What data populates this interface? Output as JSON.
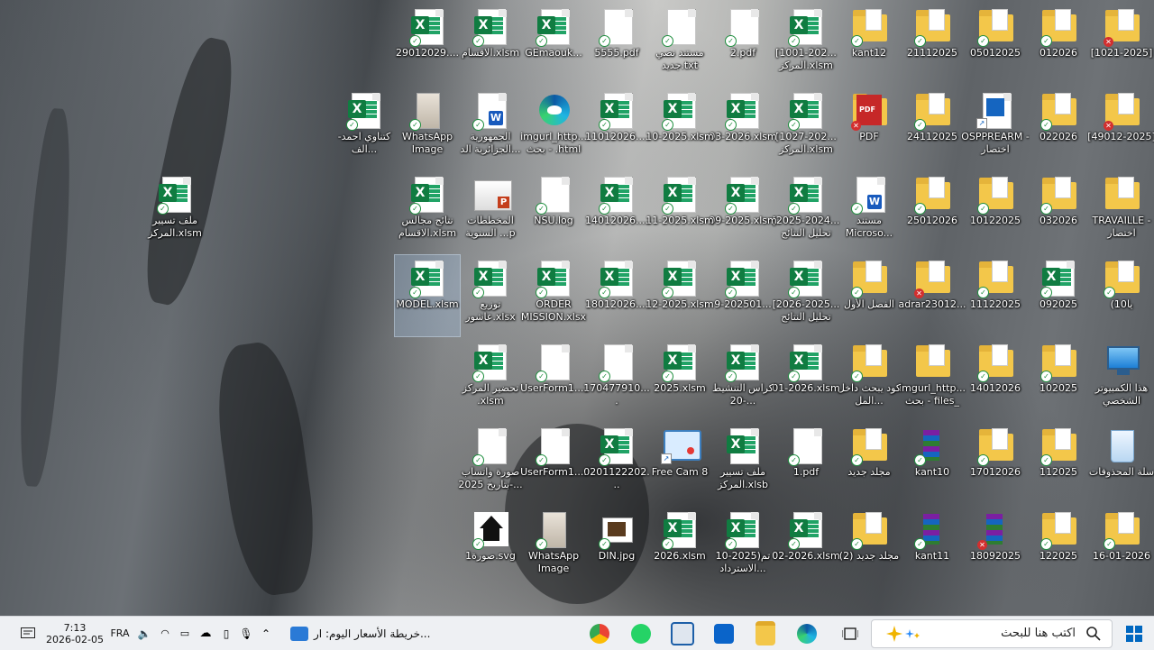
{
  "desktop": {
    "icons": [
      {
        "label": "[1021-2025]",
        "type": "folder",
        "badge": "err"
      },
      {
        "label": "012026",
        "type": "folder",
        "badge": "ok"
      },
      {
        "label": "05012025",
        "type": "folder",
        "badge": "ok"
      },
      {
        "label": "21112025",
        "type": "folder",
        "badge": "ok"
      },
      {
        "label": "kant12",
        "type": "folder",
        "badge": "ok"
      },
      {
        "label": "[1001-202... المركز.xlsm",
        "type": "excel",
        "badge": "ok"
      },
      {
        "label": "2.pdf",
        "type": "doc",
        "badge": "ok"
      },
      {
        "label": "مستند نصي جديد.txt",
        "type": "doc",
        "badge": "ok"
      },
      {
        "label": "5555.pdf",
        "type": "doc",
        "badge": "ok"
      },
      {
        "label": "GEmaouk...",
        "type": "excel",
        "badge": "ok"
      },
      {
        "label": "الاقسام.xlsm",
        "type": "excel",
        "badge": "ok"
      },
      {
        "label": "29012029....",
        "type": "excel",
        "badge": "ok"
      },
      {
        "label": "[49012-2025]",
        "type": "folder",
        "badge": "err"
      },
      {
        "label": "022026",
        "type": "folder",
        "badge": "ok"
      },
      {
        "label": "OSPPREARM - اختصار",
        "type": "app",
        "badge": ""
      },
      {
        "label": "24112025",
        "type": "folder",
        "badge": "ok"
      },
      {
        "label": "PDF",
        "type": "pdf",
        "badge": "err"
      },
      {
        "label": "[1027-202... المركز.xlsm",
        "type": "excel",
        "badge": "ok"
      },
      {
        "label": "03-2026.xlsm",
        "type": "excel",
        "badge": "ok"
      },
      {
        "label": "10-2025.xlsm",
        "type": "excel",
        "badge": "ok"
      },
      {
        "label": "11012026....",
        "type": "excel",
        "badge": "ok"
      },
      {
        "label": "imgurl_http... بحث - .html",
        "type": "edge",
        "badge": ""
      },
      {
        "label": "الجمهورية الجزائرية الد...",
        "type": "word",
        "badge": "ok"
      },
      {
        "label": "WhatsApp Image 2026....",
        "type": "photo",
        "badge": "ok"
      },
      {
        "label": "كتناوي احمد-الف...",
        "type": "excel",
        "badge": "ok"
      },
      {
        "label": "TRAVAILLE - اختصار",
        "type": "folder",
        "badge": ""
      },
      {
        "label": "032026",
        "type": "folder",
        "badge": "ok"
      },
      {
        "label": "10122025",
        "type": "folder",
        "badge": "ok"
      },
      {
        "label": "25012026",
        "type": "folder",
        "badge": "ok"
      },
      {
        "label": "مستند Microso...",
        "type": "word",
        "badge": "ok"
      },
      {
        "label": "[2025-2024... تحليل النتائج",
        "type": "excel",
        "badge": "ok"
      },
      {
        "label": "09-2025.xlsm",
        "type": "excel",
        "badge": "ok"
      },
      {
        "label": "11-2025.xlsm",
        "type": "excel",
        "badge": "ok"
      },
      {
        "label": "14012026....",
        "type": "excel",
        "badge": "ok"
      },
      {
        "label": "NSU.log",
        "type": "doc",
        "badge": "ok"
      },
      {
        "label": "المخططات السنوية ...p",
        "type": "ppt",
        "badge": ""
      },
      {
        "label": "نتائج مجالس الاقسام.xlsm",
        "type": "excel",
        "badge": "ok"
      },
      {
        "label": "ملف تسيير المركز.xlsm",
        "type": "excel",
        "badge": "ok"
      },
      {
        "label": "(10يا",
        "type": "folder",
        "badge": "ok"
      },
      {
        "label": "092025",
        "type": "excel",
        "badge": "ok"
      },
      {
        "label": "11122025",
        "type": "folder",
        "badge": "ok"
      },
      {
        "label": "adrar23012...",
        "type": "folder",
        "badge": "err"
      },
      {
        "label": "الفصل الأول",
        "type": "folder",
        "badge": "ok"
      },
      {
        "label": "[2026-2025... تحليل النتائج",
        "type": "excel",
        "badge": "ok"
      },
      {
        "label": "9-202501...",
        "type": "excel",
        "badge": "ok"
      },
      {
        "label": "12-2025.xlsm",
        "type": "excel",
        "badge": "ok"
      },
      {
        "label": "18012026....",
        "type": "excel",
        "badge": "ok"
      },
      {
        "label": "ORDER MISSION.xlsx",
        "type": "excel",
        "badge": "ok"
      },
      {
        "label": "توزيع عاشور.xlsx",
        "type": "excel",
        "badge": "ok"
      },
      {
        "label": "MODEL.xlsm",
        "type": "excel",
        "badge": "ok"
      },
      {
        "label": "هذا الكمبيوتر الشخصي",
        "type": "pc",
        "badge": ""
      },
      {
        "label": "102025",
        "type": "folder",
        "badge": "ok"
      },
      {
        "label": "14012026",
        "type": "folder",
        "badge": "ok"
      },
      {
        "label": "imgurl_http... بحث - files_",
        "type": "folder",
        "badge": ""
      },
      {
        "label": "كود يبحث داخل المل...",
        "type": "folder",
        "badge": "ok"
      },
      {
        "label": "01-2026.xlsm",
        "type": "excel",
        "badge": "ok"
      },
      {
        "label": "كراس التنشيط 20-...",
        "type": "excel",
        "badge": "ok"
      },
      {
        "label": "2025.xlsm",
        "type": "excel",
        "badge": "ok"
      },
      {
        "label": "170477910....",
        "type": "doc",
        "badge": "ok"
      },
      {
        "label": "UserForm1....",
        "type": "doc",
        "badge": "ok"
      },
      {
        "label": "تحضير المركز .xlsm",
        "type": "excel",
        "badge": "ok"
      },
      {
        "label": "سلة المحذوفات",
        "type": "bin",
        "badge": ""
      },
      {
        "label": "112025",
        "type": "folder",
        "badge": "ok"
      },
      {
        "label": "17012026",
        "type": "folder",
        "badge": "ok"
      },
      {
        "label": "kant10",
        "type": "rar",
        "badge": "ok"
      },
      {
        "label": "مجلد جديد",
        "type": "folder",
        "badge": "ok"
      },
      {
        "label": "1.pdf",
        "type": "doc",
        "badge": "ok"
      },
      {
        "label": "ملف تسيير المركز.xlsb",
        "type": "excel",
        "badge": ""
      },
      {
        "label": "Free Cam 8",
        "type": "cam",
        "badge": ""
      },
      {
        "label": "0201122202...",
        "type": "excel",
        "badge": "ok"
      },
      {
        "label": "UserForm1....",
        "type": "doc",
        "badge": "ok"
      },
      {
        "label": "صورة واتساب بتاريخ 2025-...",
        "type": "doc",
        "badge": "ok"
      },
      {
        "label": "16-01-2026",
        "type": "folder",
        "badge": "ok"
      },
      {
        "label": "122025",
        "type": "folder",
        "badge": "ok"
      },
      {
        "label": "18092025",
        "type": "rar",
        "badge": "err"
      },
      {
        "label": "kant11",
        "type": "rar",
        "badge": "ok"
      },
      {
        "label": "مجلد جديد (2)",
        "type": "folder",
        "badge": "ok"
      },
      {
        "label": "02-2026.xlsm",
        "type": "excel",
        "badge": "ok"
      },
      {
        "label": "تم(2025-10 الاسترداد...",
        "type": "excel",
        "badge": "ok"
      },
      {
        "label": "2026.xlsm",
        "type": "excel",
        "badge": "ok"
      },
      {
        "label": "DIN.jpg",
        "type": "jpg",
        "badge": "ok"
      },
      {
        "label": "WhatsApp Image 2026....",
        "type": "photo",
        "badge": "ok"
      },
      {
        "label": "صورة1.svg",
        "type": "svg",
        "badge": "ok"
      }
    ]
  },
  "taskbar": {
    "time": "7:13",
    "date": "2026-02-05",
    "lang": "FRA",
    "news": "خريطة الأسعار اليوم: ار...",
    "search_placeholder": "اكتب هنا للبحث",
    "pinned": [
      "edge-icon",
      "explorer-icon",
      "outlook-icon",
      "remote-desktop-icon",
      "whatsapp-icon",
      "chrome-icon"
    ]
  },
  "colors": {
    "taskbar_bg": "#eef0f3",
    "excel": "#107c41",
    "folder": "#f3c74a",
    "error_badge": "#d32f2f",
    "ok_badge": "#1e8e3e"
  }
}
